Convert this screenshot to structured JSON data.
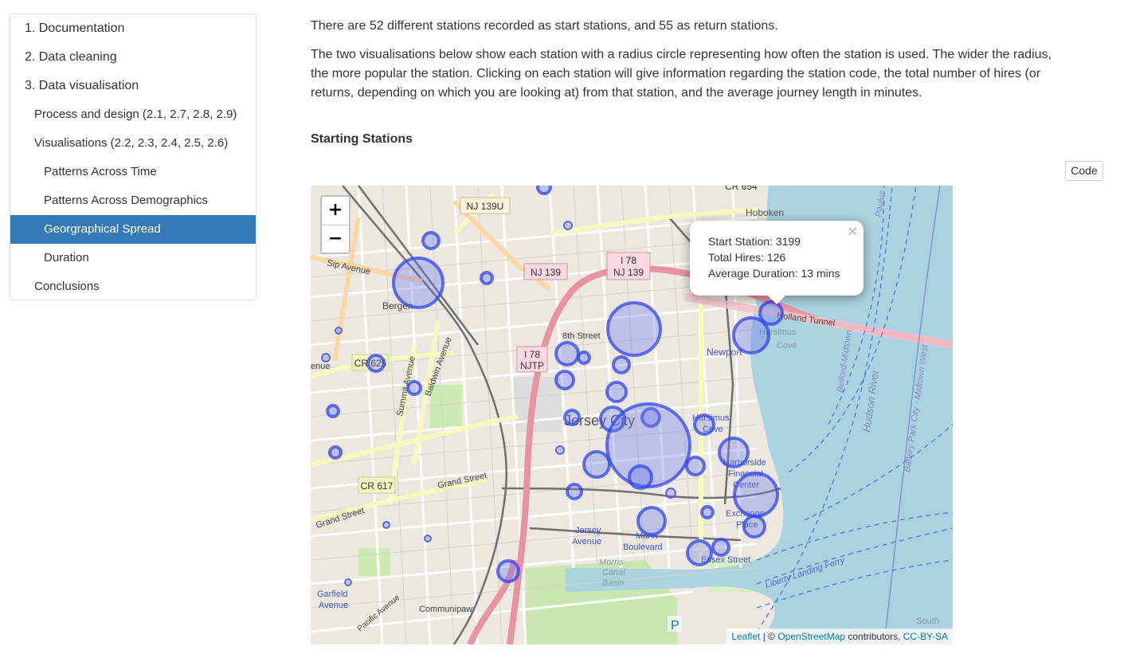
{
  "toc": {
    "items": [
      {
        "label": "1. Documentation",
        "level": 1,
        "active": false
      },
      {
        "label": "2. Data cleaning",
        "level": 1,
        "active": false
      },
      {
        "label": "3. Data visualisation",
        "level": 1,
        "active": false
      },
      {
        "label": "Process and design (2.1, 2.7, 2.8, 2.9)",
        "level": 2,
        "active": false
      },
      {
        "label": "Visualisations (2.2, 2.3, 2.4, 2.5, 2.6)",
        "level": 2,
        "active": false
      },
      {
        "label": "Patterns Across Time",
        "level": 3,
        "active": false
      },
      {
        "label": "Patterns Across Demographics",
        "level": 3,
        "active": false
      },
      {
        "label": "Georgraphical Spread",
        "level": 3,
        "active": true
      },
      {
        "label": "Duration",
        "level": 3,
        "active": false
      },
      {
        "label": "Conclusions",
        "level": 2,
        "active": false
      }
    ]
  },
  "content": {
    "para1": "There are 52 different stations recorded as start stations, and 55 as return stations.",
    "para2_line1": "The two visualisations below show each station with a radius circle representing how often the station is used. The wider the radius,",
    "para2_line2": "the more popular the station. Clicking on each station will give information regarding the station code, the total number of hires (or",
    "para2_line3": "returns, depending on which you are looking at) from that station, and the average journey length in minutes.",
    "heading": "Starting Stations",
    "code_button": "Code"
  },
  "map": {
    "zoom_in": "+",
    "zoom_out": "−",
    "popup": {
      "close": "×",
      "station": "Start Station: 3199",
      "hires": "Total Hires: 126",
      "duration": "Average Duration: 13 mins"
    },
    "attribution": {
      "leaflet": "Leaflet",
      "sep": " | © ",
      "osm": "OpenStreetMap",
      "contrib": " contributors, ",
      "license": "CC-BY-SA"
    },
    "labels": {
      "hoboken": "Hoboken",
      "nj139u": "NJ 139U",
      "nj139": "NJ 139",
      "i78a": "I 78",
      "nj139b": "NJ 139",
      "i78b": "I 78",
      "njtp": "NJTP",
      "sip": "Sip Avenue",
      "bergen": "Bergen",
      "baldwin": "Baldwin Avenue",
      "summit": "Summit Avenue",
      "cr625": "CR 625",
      "eighth": "8th Street",
      "holland": "Holland Tunnel",
      "newport": "Newport",
      "harsimus1": "Harsimus",
      "cove1": "Cove",
      "jersey_city": "Jersey City",
      "harsimus2": "Harsimus",
      "cove2": "Cove",
      "harborside1": "Harborside",
      "harborside2": "Financial",
      "harborside3": "Center",
      "exchange1": "Exchange",
      "exchange2": "Place",
      "cr617": "CR 617",
      "grand1": "Grand Street",
      "grand2": "Grand Street",
      "jersey_ave1": "Jersey",
      "jersey_ave2": "Avenue",
      "marin1": "Marin",
      "marin2": "Boulevard",
      "essex": "Essex Street",
      "morris1": "Morris",
      "morris2": "Canal",
      "morris3": "Basin",
      "liberty": "Liberty Landing Ferry",
      "garfield1": "Garfield",
      "garfield2": "Avenue",
      "communipaw": "Communipaw",
      "pacific": "Pacific Avenue",
      "hudson": "Hudson River",
      "belford": "Belford-Midtown",
      "battery": "Battery Park City - Midtown West",
      "paulus": "Paulus",
      "south": "South",
      "parking": "P",
      "enue": "enue",
      "cr654": "CR 654"
    },
    "colors": {
      "station_fill": "#6677ee",
      "station_stroke": "#3344ee",
      "water": "#aad3df",
      "motorway": "#e892a2",
      "primary": "#fcd6a4",
      "secondary": "#f7fabf"
    }
  }
}
